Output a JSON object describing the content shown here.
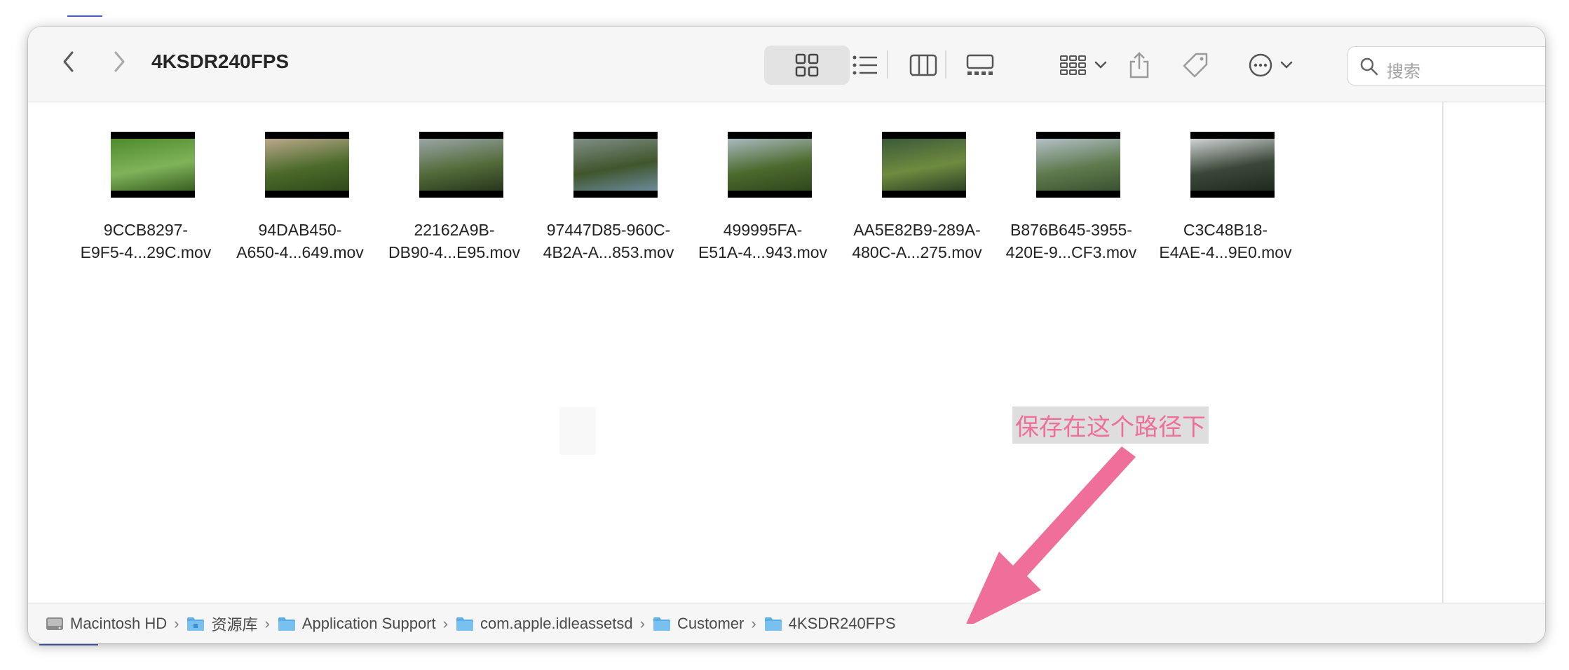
{
  "window": {
    "title": "4KSDR240FPS",
    "nav": {
      "back_icon": "chevron-left-icon",
      "forward_icon": "chevron-right-icon"
    },
    "toolbar": {
      "views": [
        "icon-view",
        "list-view",
        "column-view",
        "gallery-view"
      ],
      "active_view": "icon-view",
      "group_icon": "group-grid-icon",
      "share_icon": "share-icon",
      "tag_icon": "tag-icon",
      "more_icon": "ellipsis-circle-icon"
    },
    "search": {
      "placeholder": "搜索"
    }
  },
  "files": [
    {
      "line1": "9CCB8297-",
      "line2": "E9F5-4...29C.mov",
      "colors": [
        "#4f8a2f",
        "#7fb35a",
        "#3a5f22"
      ]
    },
    {
      "line1": "94DAB450-",
      "line2": "A650-4...649.mov",
      "colors": [
        "#b9a88a",
        "#4c6a2a",
        "#2f4a1a"
      ]
    },
    {
      "line1": "22162A9B-",
      "line2": "DB90-4...E95.mov",
      "colors": [
        "#9aa5a6",
        "#536b3a",
        "#27361c"
      ]
    },
    {
      "line1": "97447D85-960C-",
      "line2": "4B2A-A...853.mov",
      "colors": [
        "#7f8f86",
        "#40552c",
        "#6a8b9a"
      ]
    },
    {
      "line1": "499995FA-",
      "line2": "E51A-4...943.mov",
      "colors": [
        "#a9b9be",
        "#4b6a2d",
        "#30461d"
      ]
    },
    {
      "line1": "AA5E82B9-289A-",
      "line2": "480C-A...275.mov",
      "colors": [
        "#3b5a3a",
        "#6f8b3f",
        "#2c4126"
      ]
    },
    {
      "line1": "B876B645-3955-",
      "line2": "420E-9...CF3.mov",
      "colors": [
        "#b3c0c6",
        "#5f7a4e",
        "#3a5230"
      ]
    },
    {
      "line1": "C3C48B18-",
      "line2": "E4AE-4...9E0.mov",
      "colors": [
        "#cfd2d2",
        "#3a4738",
        "#1f2a1f"
      ]
    }
  ],
  "pathbar": [
    {
      "label": "Macintosh HD",
      "icon": "hard-drive-icon"
    },
    {
      "label": "资源库",
      "icon": "library-folder-icon"
    },
    {
      "label": "Application Support",
      "icon": "folder-icon"
    },
    {
      "label": "com.apple.idleassetsd",
      "icon": "folder-icon"
    },
    {
      "label": "Customer",
      "icon": "folder-icon"
    },
    {
      "label": "4KSDR240FPS",
      "icon": "folder-icon"
    }
  ],
  "annotation": {
    "text": "保存在这个路径下",
    "color": "#ef6f9a"
  }
}
